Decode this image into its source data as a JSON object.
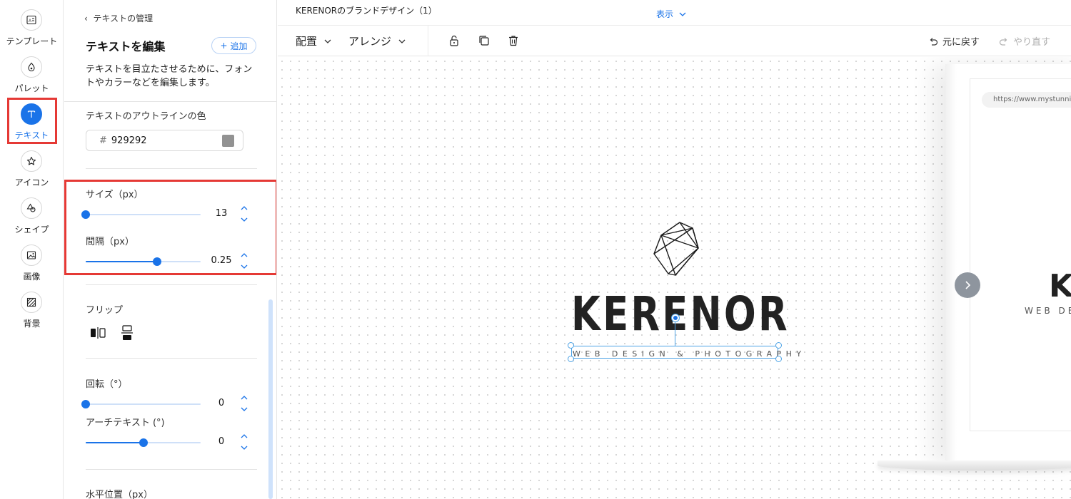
{
  "rail": {
    "items": [
      {
        "label": "テンプレート",
        "icon": "template-icon"
      },
      {
        "label": "パレット",
        "icon": "palette-icon"
      },
      {
        "label": "テキスト",
        "icon": "text-icon",
        "active": true
      },
      {
        "label": "アイコン",
        "icon": "star-icon"
      },
      {
        "label": "シェイプ",
        "icon": "shape-icon"
      },
      {
        "label": "画像",
        "icon": "image-icon"
      },
      {
        "label": "背景",
        "icon": "background-icon"
      }
    ],
    "active_color": "#1a73e8"
  },
  "panel": {
    "back_label": "テキストの管理",
    "title": "テキストを編集",
    "add_label": "追加",
    "description": "テキストを目立たさせるために、フォントやカラーなどを編集します。",
    "outline_color_label": "テキストのアウトラインの色",
    "outline_color_hash": "#",
    "outline_color_value": "929292",
    "size_label": "サイズ（px）",
    "size_value": "13",
    "size_fraction": 0.0,
    "spacing_label": "間隔（px）",
    "spacing_value": "0.25",
    "spacing_fraction": 0.62,
    "flip_label": "フリップ",
    "rotation_label": "回転（°）",
    "rotation_value": "0",
    "rotation_fraction": 0.0,
    "arch_label": "アーチテキスト (°)",
    "arch_value": "0",
    "arch_fraction": 0.5,
    "hpos_label": "水平位置（px）"
  },
  "topbar": {
    "doc_title": "KERENORのブランドデザイン（1）",
    "view_label": "表示",
    "arrange_label": "配置",
    "align_label": "アレンジ",
    "undo_label": "元に戻す",
    "redo_label": "やり直す"
  },
  "canvas": {
    "logo_name": "KERENOR",
    "logo_tagline": "WEB DESIGN & PHOTOGRAPHY",
    "preview_url": "https://www.mystunnin",
    "preview_logo": "K",
    "preview_tagline": "WEB DES"
  },
  "colors": {
    "accent": "#1a73e8",
    "highlight": "#e53935",
    "outline_swatch": "#929292"
  }
}
